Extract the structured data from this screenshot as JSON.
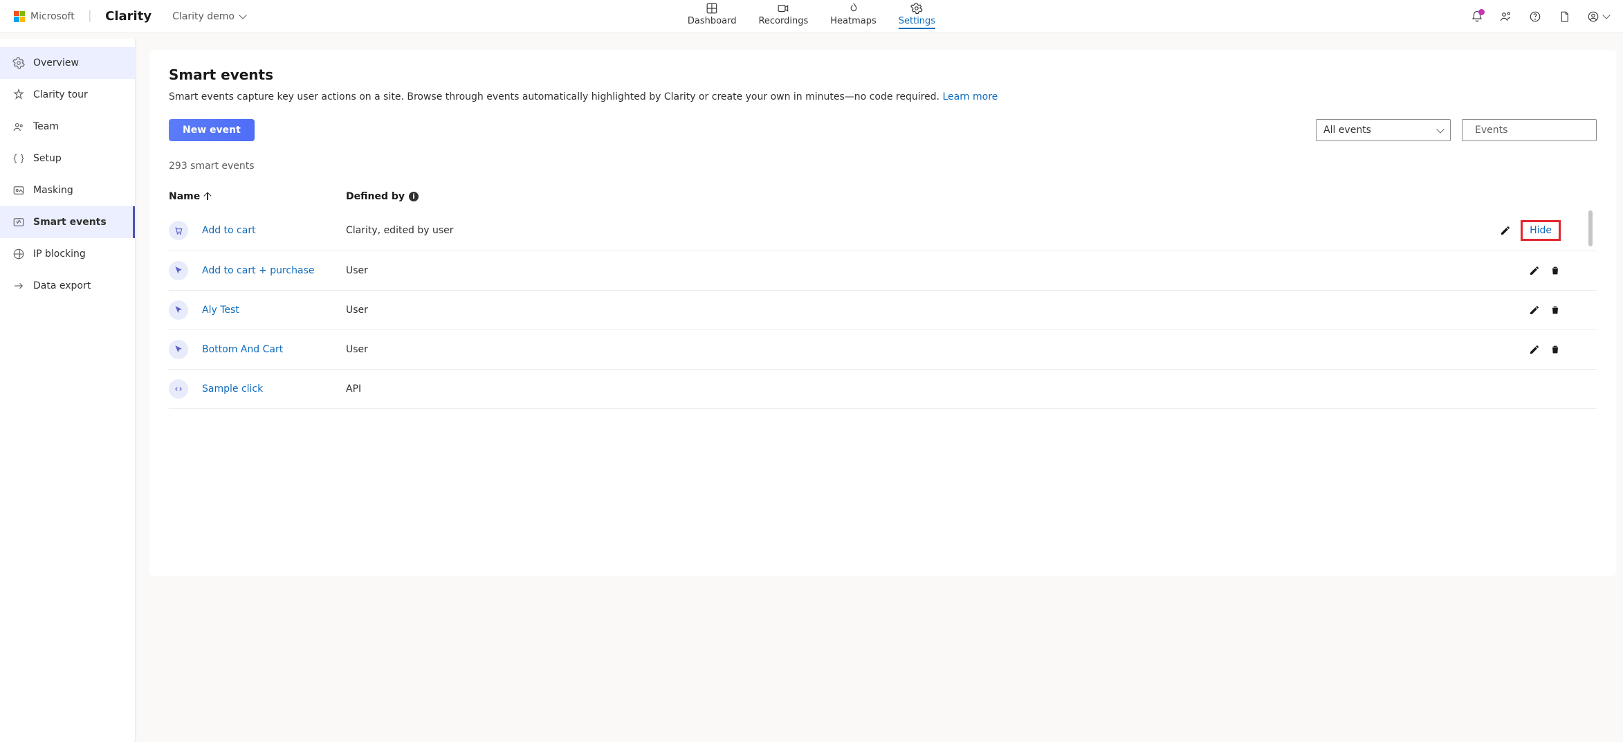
{
  "brand": {
    "company": "Microsoft",
    "product": "Clarity"
  },
  "project": {
    "name": "Clarity demo"
  },
  "nav": {
    "tabs": [
      {
        "label": "Dashboard"
      },
      {
        "label": "Recordings"
      },
      {
        "label": "Heatmaps"
      },
      {
        "label": "Settings"
      }
    ]
  },
  "sidebar": {
    "items": [
      {
        "label": "Overview"
      },
      {
        "label": "Clarity tour"
      },
      {
        "label": "Team"
      },
      {
        "label": "Setup"
      },
      {
        "label": "Masking"
      },
      {
        "label": "Smart events"
      },
      {
        "label": "IP blocking"
      },
      {
        "label": "Data export"
      }
    ]
  },
  "page": {
    "title": "Smart events",
    "subtitle": "Smart events capture key user actions on a site. Browse through events automatically highlighted by Clarity or create your own in minutes—no code required. ",
    "learn_more": "Learn more",
    "new_event_label": "New event",
    "filter_label": "All events",
    "search_placeholder": "Events",
    "count_text": "293 smart events",
    "col_name": "Name",
    "col_defined": "Defined by",
    "hide_label": "Hide",
    "events": [
      {
        "name": "Add to cart",
        "defined_by": "Clarity, edited by user",
        "icon": "cart",
        "actions": "edit-hide"
      },
      {
        "name": "Add to cart + purchase",
        "defined_by": "User",
        "icon": "cursor",
        "actions": "edit-delete"
      },
      {
        "name": "Aly Test",
        "defined_by": "User",
        "icon": "cursor",
        "actions": "edit-delete"
      },
      {
        "name": "Bottom And Cart",
        "defined_by": "User",
        "icon": "cursor",
        "actions": "edit-delete"
      },
      {
        "name": "Sample click",
        "defined_by": "API",
        "icon": "code",
        "actions": "none"
      }
    ]
  }
}
